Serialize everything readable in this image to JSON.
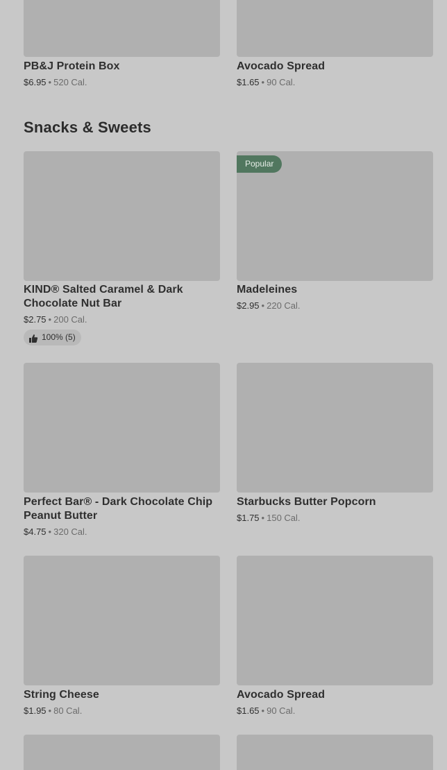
{
  "section": {
    "title": "Snacks & Sweets"
  },
  "items": [
    {
      "name": "PB&J Protein Box",
      "price": "$6.95",
      "sep": "•",
      "calories": "520 Cal."
    },
    {
      "name": "Avocado Spread",
      "price": "$1.65",
      "sep": "•",
      "calories": "90 Cal."
    },
    {
      "name": "KIND® Salted Caramel & Dark Chocolate Nut Bar",
      "price": "$2.75",
      "sep": "•",
      "calories": "200 Cal.",
      "rating": "100% (5)"
    },
    {
      "name": "Madeleines",
      "price": "$2.95",
      "sep": "•",
      "calories": "220 Cal.",
      "badge": "Popular"
    },
    {
      "name": "Perfect Bar® - Dark Chocolate Chip Peanut Butter",
      "price": "$4.75",
      "sep": "•",
      "calories": "320 Cal."
    },
    {
      "name": "Starbucks Butter Popcorn",
      "price": "$1.75",
      "sep": "•",
      "calories": "150 Cal."
    },
    {
      "name": "String Cheese",
      "price": "$1.95",
      "sep": "•",
      "calories": "80 Cal."
    },
    {
      "name": "Avocado Spread",
      "price": "$1.65",
      "sep": "•",
      "calories": "90 Cal."
    }
  ],
  "icons": {
    "rating": "thumbs-up-icon"
  },
  "colors": {
    "page_bg": "#c8c8c8",
    "image_placeholder": "#b0b0b0",
    "badge_bg": "#51775f",
    "text": "#2f2f2f",
    "muted": "#6b6b6b"
  }
}
